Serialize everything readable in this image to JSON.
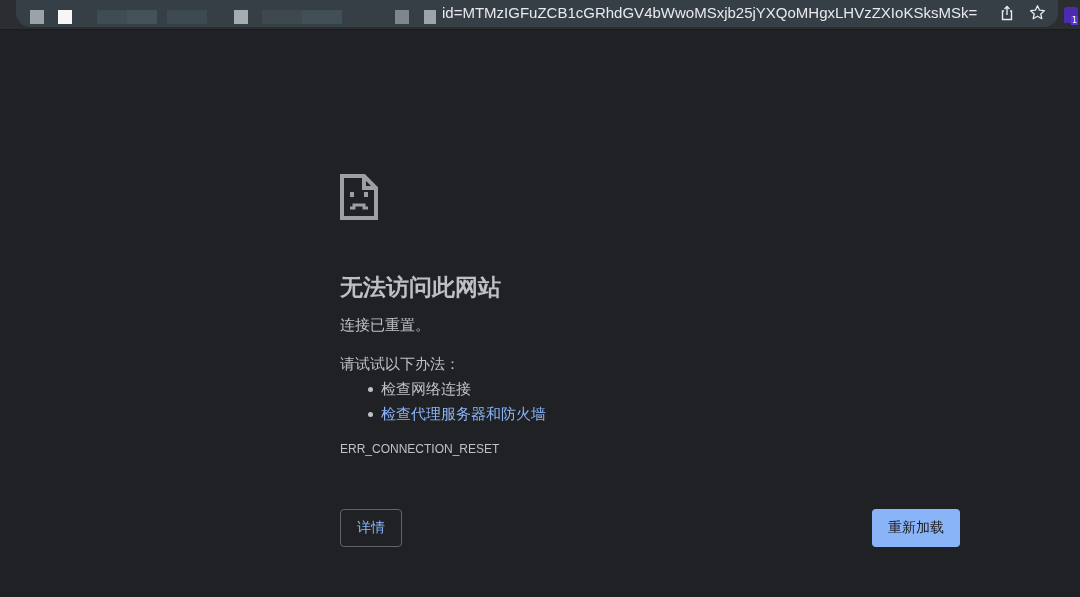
{
  "address_bar": {
    "url": "id=MTMzIGFuZCB1cGRhdGV4bWwoMSxjb25jYXQoMHgxLHVzZXIoKSksMSk="
  },
  "extension_badge": "1",
  "error": {
    "title": "无法访问此网站",
    "message": "连接已重置。",
    "suggestions_heading": "请试试以下办法：",
    "suggestions": [
      {
        "text": "检查网络连接",
        "kind": "text"
      },
      {
        "text": "检查代理服务器和防火墙",
        "kind": "link"
      }
    ],
    "code": "ERR_CONNECTION_RESET"
  },
  "buttons": [
    {
      "label": "详情",
      "kind": "secondary"
    },
    {
      "label": "重新加载",
      "kind": "primary"
    }
  ]
}
